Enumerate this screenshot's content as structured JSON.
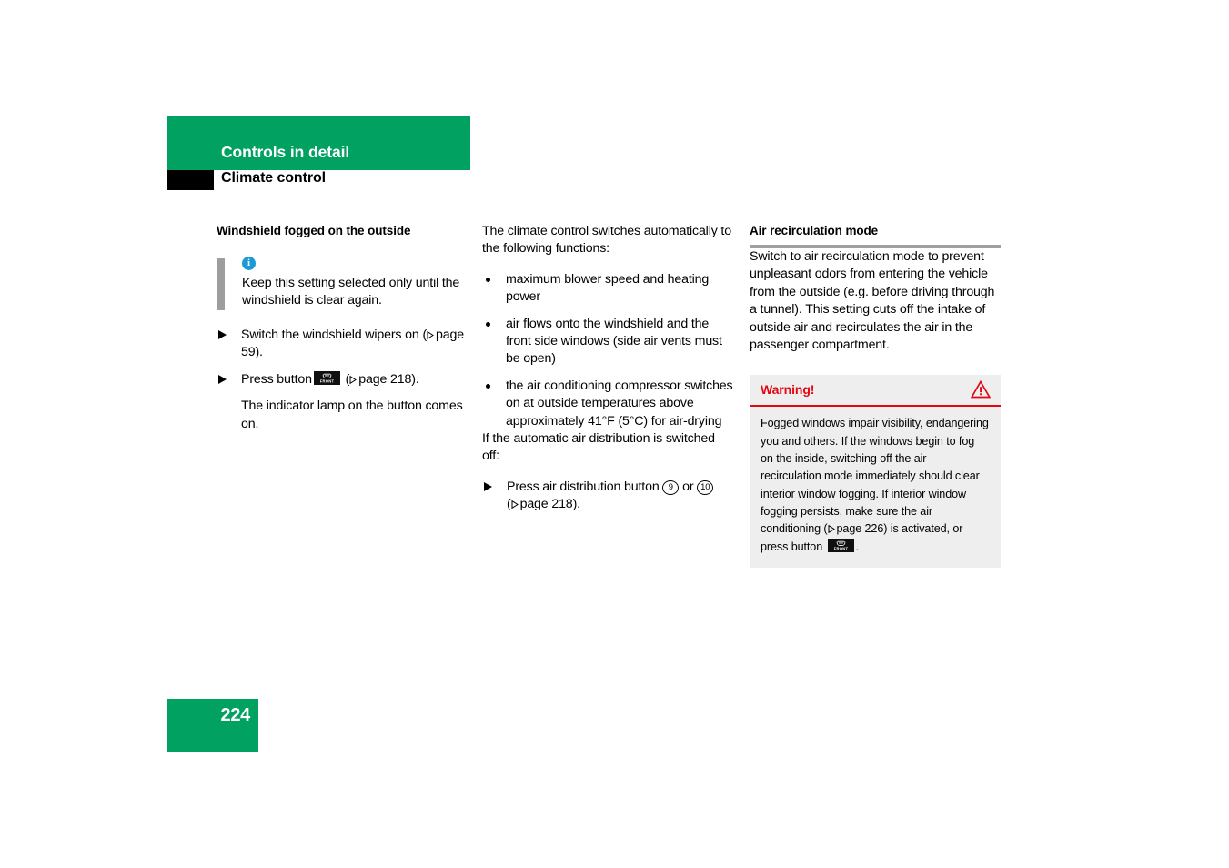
{
  "header": {
    "chapter_title": "Controls in detail",
    "section_title": "Climate control",
    "accent_color": "#00a161",
    "tab_color": "#000000"
  },
  "footer": {
    "page_number": "224"
  },
  "left_column": {
    "heading": "Windshield fogged on the outside",
    "note": {
      "icon": "info-icon",
      "icon_color": "#1b9ad6",
      "bar_color": "#9d9d9d",
      "text": "Keep this setting selected only until the windshield is clear again."
    },
    "steps": [
      {
        "text_before": "Switch the windshield wipers on (",
        "ref_label": "page 59",
        "text_after": ")."
      },
      {
        "text_before": "Press button",
        "button_icon": "defroster-button-icon",
        "ref_open": "(",
        "ref_label": "page 218",
        "text_after": ")."
      }
    ],
    "step_followup": "The indicator lamp on the button comes on."
  },
  "middle_column": {
    "intro": "The climate control switches automatically to the following functions:",
    "bullets": [
      "maximum blower speed and heating power",
      "air flows onto the windshield and the front side windows (side air vents must be open)",
      "the air conditioning compressor switches on at outside temperatures above approximately 41°F (5°C) for air-drying"
    ],
    "secondary_intro": "If the automatic air distribution is switched off:",
    "step": {
      "text_before": "Press air distribution button",
      "option_a": "9",
      "conjunction": "or",
      "option_b": "10",
      "ref_open": "(",
      "ref_label": "page 218",
      "text_after": ")."
    }
  },
  "right_column": {
    "heading": "Air recirculation mode",
    "rule_color": "#a0a0a0",
    "body": "Switch to air recirculation mode to prevent unpleasant odors from entering the vehicle from the outside (e.g. before driving through a tunnel). This setting cuts off the intake of outside air and recirculates the air in the passenger compartment.",
    "warning": {
      "label": "Warning!",
      "icon": "warning-triangle-icon",
      "accent_color": "#e30613",
      "background_color": "#eeeeee",
      "text_part1": "Fogged windows impair visibility, endangering you and others. If the windows begin to fog on the inside, switching off the air recirculation mode immediately should clear interior window fogging. If interior window fogging persists, make sure the air conditioning (",
      "ref_label": "page 226",
      "text_part2": ") is activated, or press button",
      "button_icon": "defroster-button-icon",
      "text_part3": "."
    }
  }
}
